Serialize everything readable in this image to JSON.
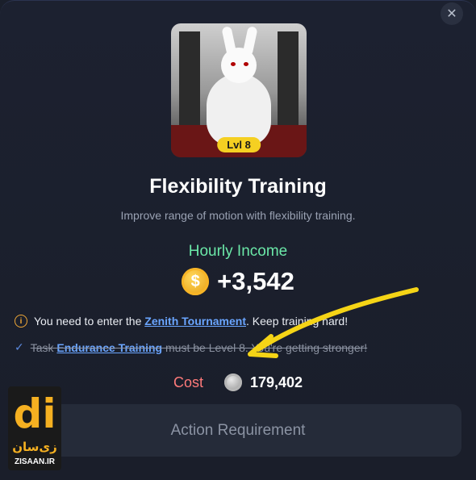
{
  "close": {
    "icon": "close-icon",
    "glyph": "✕"
  },
  "card": {
    "level_badge": "Lvl 8"
  },
  "title": "Flexibility Training",
  "subtitle": "Improve range of motion with flexibility training.",
  "income": {
    "label": "Hourly Income",
    "value": "+3,542",
    "coin_glyph": "$"
  },
  "requirements": [
    {
      "icon": "info-icon",
      "glyph": "i",
      "prefix": "You need to enter the ",
      "link": "Zenith Tournament",
      "suffix": ". Keep training hard!",
      "completed": false
    },
    {
      "icon": "check-icon",
      "glyph": "✓",
      "prefix": "Task ",
      "link": "Endurance Training",
      "suffix": " must be Level 8. You're getting stronger!",
      "completed": true
    }
  ],
  "cost": {
    "label": "Cost",
    "value": "179,402"
  },
  "action_button": {
    "label": "Action Requirement"
  },
  "watermark": {
    "logo": "di",
    "fa": "زی‌سان",
    "en": "ZISAAN.IR"
  },
  "colors": {
    "income": "#6be8a8",
    "cost_label": "#ff7a7a",
    "link": "#6aa5ff",
    "badge": "#f5d022",
    "arrow": "#f5d416"
  }
}
